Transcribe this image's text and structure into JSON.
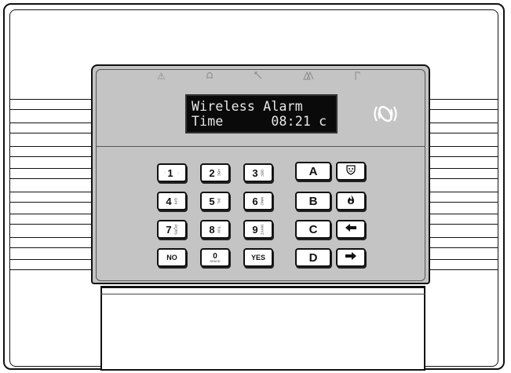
{
  "indicators": [
    {
      "name": "alarm-triangle-icon",
      "glyph": "⚠"
    },
    {
      "name": "bell-icon",
      "glyph": "🔔"
    },
    {
      "name": "wireless-signal-icon",
      "glyph": "↖"
    },
    {
      "name": "fault-icon",
      "glyph": "⚠"
    },
    {
      "name": "tamper-icon",
      "glyph": "Γ"
    }
  ],
  "display": {
    "line1": "Wireless Alarm",
    "line2": "Time      08:21 c"
  },
  "keypad": {
    "rows": [
      [
        {
          "label": "1",
          "pre": "'",
          "sub": "‘"
        },
        {
          "label": "2",
          "sub": "ABC"
        },
        {
          "label": "3",
          "sub": "DEF"
        }
      ],
      [
        {
          "label": "4",
          "sub": "GHI"
        },
        {
          "label": "5",
          "sub": "JKL"
        },
        {
          "label": "6",
          "sub": "MNO"
        }
      ],
      [
        {
          "label": "7",
          "sub": "PQRS"
        },
        {
          "label": "8",
          "sub": "TUV"
        },
        {
          "label": "9",
          "sub": "WXYZ"
        }
      ],
      [
        {
          "label": "NO"
        },
        {
          "label": "0",
          "sub": "SPACE"
        },
        {
          "label": "YES"
        }
      ]
    ],
    "function_keys": [
      "A",
      "B",
      "C",
      "D"
    ],
    "icon_keys": [
      "police-shield-icon",
      "fire-icon",
      "left-arrow-icon",
      "right-arrow-icon"
    ]
  },
  "colors": {
    "panel": "#c4c4c4",
    "lcd_bg": "#0a0a0a",
    "lcd_text": "#e8e8e8",
    "outline": "#111111"
  }
}
